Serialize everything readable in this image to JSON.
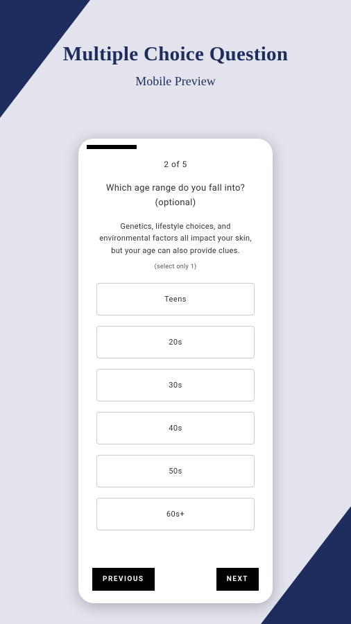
{
  "header": {
    "title": "Multiple Choice Question",
    "subtitle": "Mobile Preview"
  },
  "quiz": {
    "step_indicator": "2  of  5",
    "question": "Which age range do you fall into? (optional)",
    "description": "Genetics, lifestyle choices, and environmental factors all impact your skin, but your age can also provide clues.",
    "select_hint": "(select only 1)",
    "options": [
      "Teens",
      "20s",
      "30s",
      "40s",
      "50s",
      "60s+"
    ],
    "nav": {
      "previous": "PREVIOUS",
      "next": "NEXT"
    }
  }
}
